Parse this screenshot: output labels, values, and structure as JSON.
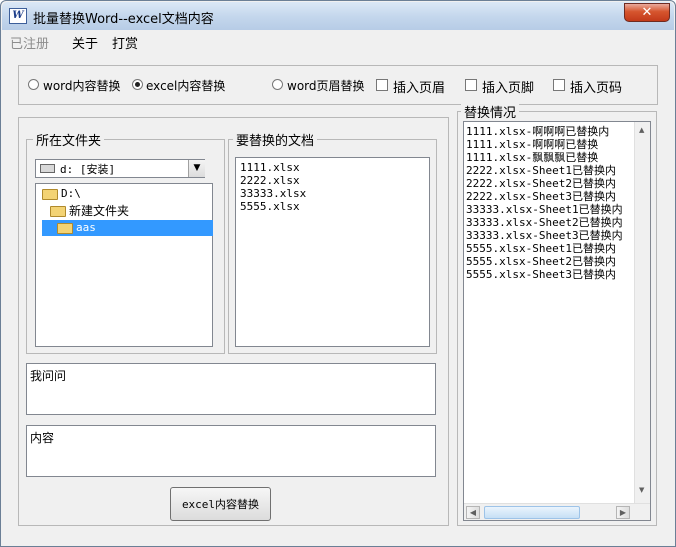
{
  "window": {
    "title": "批量替换Word--excel文档内容",
    "icon_text": "W"
  },
  "menu": {
    "items": [
      "已注册",
      "关于",
      "打赏"
    ]
  },
  "options": {
    "radio_word_content": "word内容替换",
    "radio_excel_content": "excel内容替换",
    "radio_word_header": "word页眉替换",
    "check_insert_header": "插入页眉",
    "check_insert_footer": "插入页脚",
    "check_insert_pagenum": "插入页码",
    "selected": "excel_content"
  },
  "folder_group": {
    "legend": "所在文件夹",
    "drive_value": "d: [安装]",
    "tree": [
      "D:\\",
      "新建文件夹",
      "aas"
    ],
    "selected_index": 2
  },
  "docs_group": {
    "legend": "要替换的文档",
    "files": [
      "1111.xlsx",
      "2222.xlsx",
      "33333.xlsx",
      "5555.xlsx"
    ]
  },
  "find_text": "我问问",
  "replace_text": "内容",
  "action_button": "excel内容替换",
  "status_group": {
    "legend": "替换情况",
    "lines": [
      "1111.xlsx-啊啊啊已替换内",
      "1111.xlsx-啊啊啊已替换",
      "1111.xlsx-飘飘飘已替换",
      "2222.xlsx-Sheet1已替换内",
      "2222.xlsx-Sheet2已替换内",
      "2222.xlsx-Sheet3已替换内",
      "33333.xlsx-Sheet1已替换内",
      "33333.xlsx-Sheet2已替换内",
      "33333.xlsx-Sheet3已替换内",
      "5555.xlsx-Sheet1已替换内",
      "5555.xlsx-Sheet2已替换内",
      "5555.xlsx-Sheet3已替换内"
    ]
  }
}
